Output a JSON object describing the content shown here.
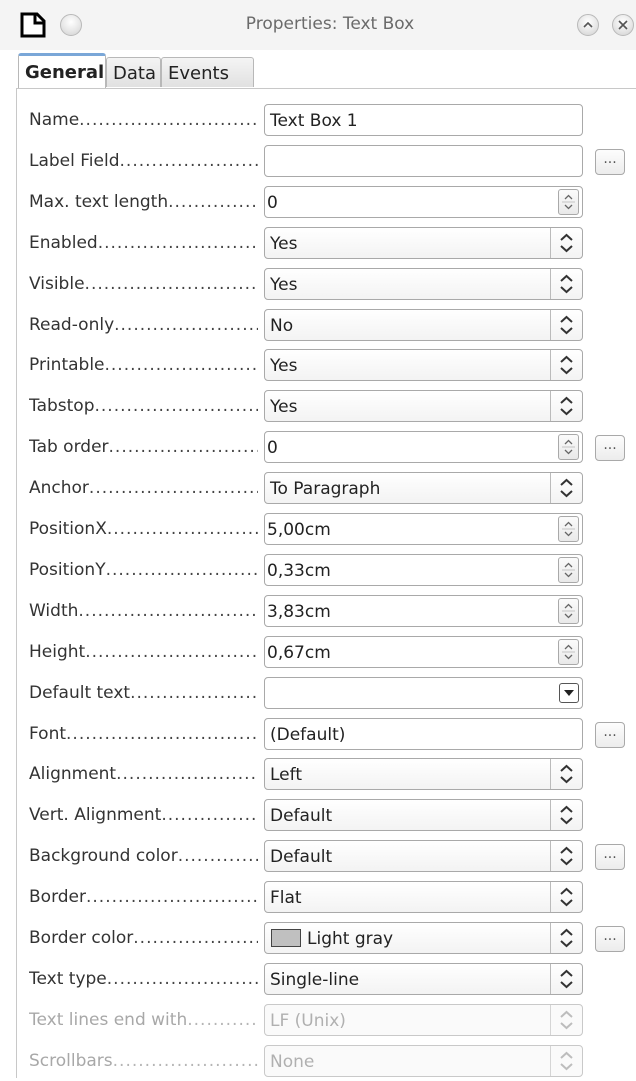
{
  "window": {
    "title": "Properties: Text Box"
  },
  "icons": {
    "app": "properties-document-icon",
    "menu": "window-menu-icon",
    "minimize": "minimize-chevron-icon",
    "close": "close-icon"
  },
  "colors": {
    "accent_tab": "#7aa7d8",
    "swatch_light_gray": "#c0c0c0"
  },
  "tabs": [
    {
      "label": "General",
      "active": true
    },
    {
      "label": "Data",
      "active": false
    },
    {
      "label": "Events",
      "active": false
    }
  ],
  "properties": [
    {
      "label": "Name",
      "value": "Text Box 1",
      "kind": "text"
    },
    {
      "label": "Label Field",
      "value": "",
      "kind": "text",
      "button": "..."
    },
    {
      "label": "Max. text length",
      "value": "0",
      "kind": "spin"
    },
    {
      "label": "Enabled",
      "value": "Yes",
      "kind": "combo"
    },
    {
      "label": "Visible",
      "value": "Yes",
      "kind": "combo"
    },
    {
      "label": "Read-only",
      "value": "No",
      "kind": "combo"
    },
    {
      "label": "Printable",
      "value": "Yes",
      "kind": "combo"
    },
    {
      "label": "Tabstop",
      "value": "Yes",
      "kind": "combo"
    },
    {
      "label": "Tab order",
      "value": "0",
      "kind": "spin",
      "button": "..."
    },
    {
      "label": "Anchor",
      "value": "To Paragraph",
      "kind": "combo"
    },
    {
      "label": "PositionX",
      "value": "5,00cm",
      "kind": "spin"
    },
    {
      "label": "PositionY",
      "value": "0,33cm",
      "kind": "spin"
    },
    {
      "label": "Width",
      "value": "3,83cm",
      "kind": "spin"
    },
    {
      "label": "Height",
      "value": "0,67cm",
      "kind": "spin"
    },
    {
      "label": "Default text",
      "value": "",
      "kind": "dropdown"
    },
    {
      "label": "Font",
      "value": "(Default)",
      "kind": "text",
      "button": "..."
    },
    {
      "label": "Alignment",
      "value": "Left",
      "kind": "combo"
    },
    {
      "label": "Vert. Alignment",
      "value": "Default",
      "kind": "combo"
    },
    {
      "label": "Background color",
      "value": "Default",
      "kind": "combo",
      "button": "..."
    },
    {
      "label": "Border",
      "value": "Flat",
      "kind": "combo"
    },
    {
      "label": "Border color",
      "value": "Light gray",
      "kind": "combo",
      "swatch": "#c0c0c0",
      "button": "..."
    },
    {
      "label": "Text type",
      "value": "Single-line",
      "kind": "combo"
    },
    {
      "label": "Text lines end with",
      "value": "LF (Unix)",
      "kind": "combo",
      "disabled": true
    },
    {
      "label": "Scrollbars",
      "value": "None",
      "kind": "combo",
      "disabled": true
    }
  ]
}
